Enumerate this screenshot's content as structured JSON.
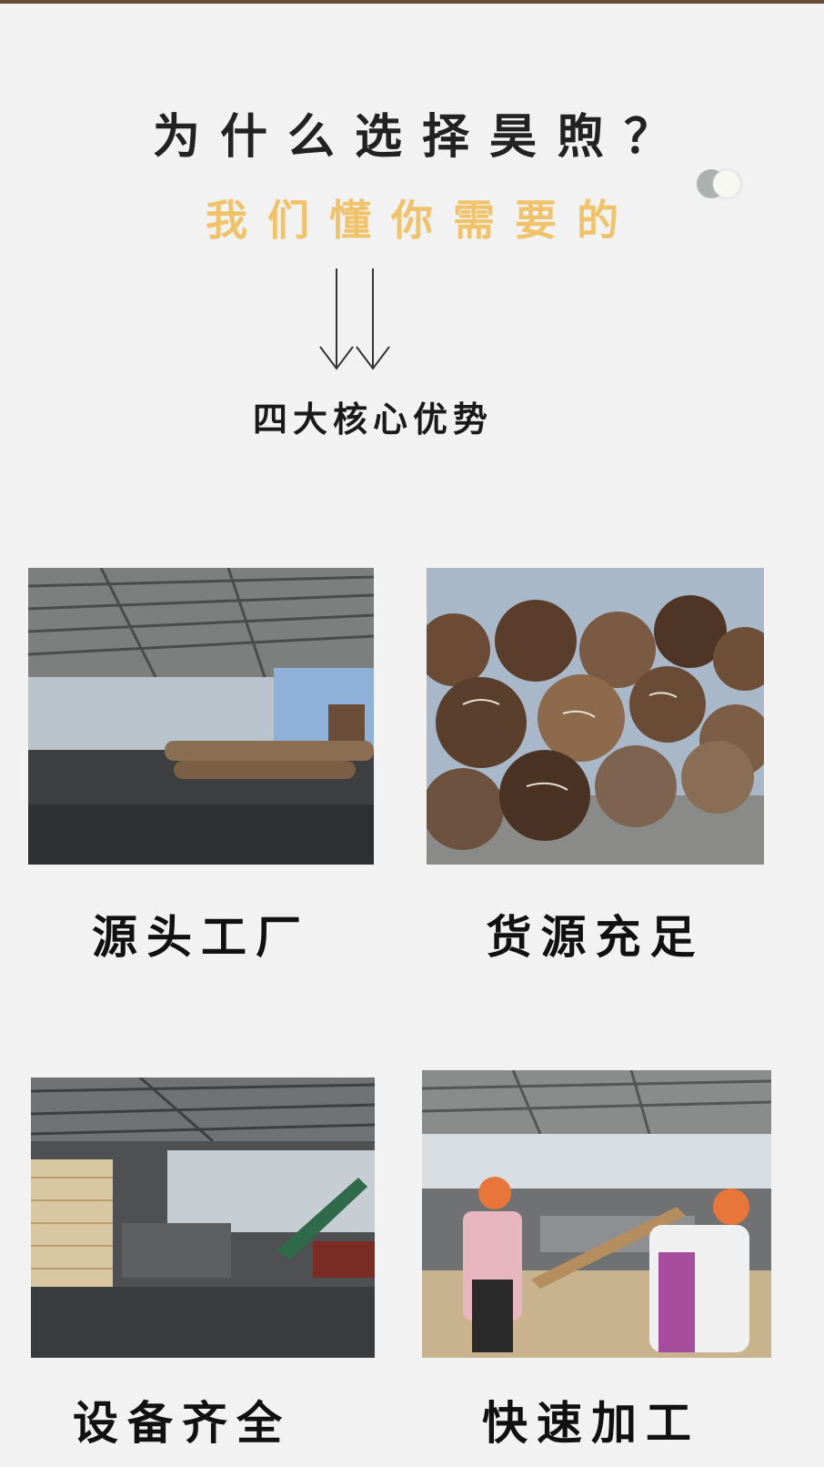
{
  "header": {
    "title": "为什么选择昊煦？",
    "subtitle": "我们懂你需要的",
    "section_label": "四大核心优势"
  },
  "features": [
    {
      "label": "源头工厂",
      "image": "sawmill-shed-with-logs"
    },
    {
      "label": "货源充足",
      "image": "stacked-hardwood-logs"
    },
    {
      "label": "设备齐全",
      "image": "workshop-equipment-and-planks"
    },
    {
      "label": "快速加工",
      "image": "workers-processing-timber"
    }
  ],
  "colors": {
    "background": "#f2f2f3",
    "title": "#222222",
    "subtitle_accent": "#f0c36a"
  }
}
